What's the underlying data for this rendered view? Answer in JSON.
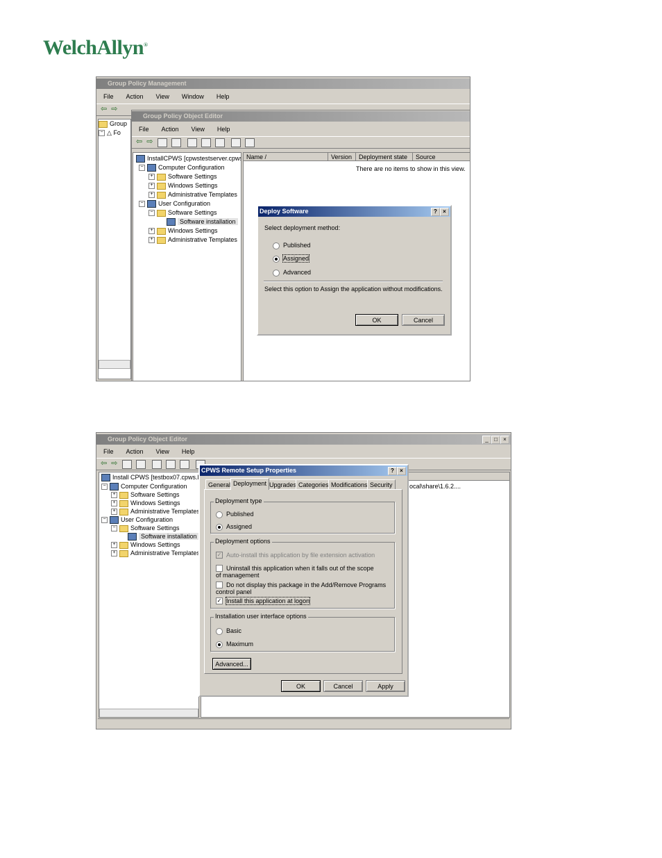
{
  "logo": {
    "text": "WelchAllyn",
    "reg": "®"
  },
  "s1": {
    "gpm": {
      "title": "Group Policy Management",
      "menu": [
        "File",
        "Action",
        "View",
        "Window",
        "Help"
      ],
      "tree": [
        "Group",
        "Fo"
      ]
    },
    "gpoe": {
      "title": "Group Policy Object Editor",
      "menu": [
        "File",
        "Action",
        "View",
        "Help"
      ],
      "tree": [
        "InstallCPWS [cpwstestserver.cpws",
        "Computer Configuration",
        "Software Settings",
        "Windows Settings",
        "Administrative Templates",
        "User Configuration",
        "Software Settings",
        "Software installation",
        "Windows Settings",
        "Administrative Templates"
      ],
      "columns": [
        "Name",
        "Version",
        "Deployment state",
        "Source"
      ],
      "empty": "There are no items to show in this view."
    },
    "deploy": {
      "title": "Deploy Software",
      "prompt": "Select deployment method:",
      "options": [
        "Published",
        "Assigned",
        "Advanced"
      ],
      "desc": "Select this option to Assign the application without modifications.",
      "ok": "OK",
      "cancel": "Cancel",
      "help": "?",
      "close": "×"
    }
  },
  "s2": {
    "gpoe": {
      "title": "Group Policy Object Editor",
      "menu": [
        "File",
        "Action",
        "View",
        "Help"
      ],
      "tree": [
        "Install CPWS [testbox07.cpws.loca",
        "Computer Configuration",
        "Software Settings",
        "Windows Settings",
        "Administrative Templates",
        "User Configuration",
        "Software Settings",
        "Software installation",
        "Windows Settings",
        "Administrative Templates"
      ],
      "source": "ocal\\share\\1.6.2....",
      "min": "_",
      "max": "□",
      "close": "×"
    },
    "props": {
      "title": "CPWS Remote Setup Properties",
      "help": "?",
      "close": "×",
      "tabs": [
        "General",
        "Deployment",
        "Upgrades",
        "Categories",
        "Modifications",
        "Security"
      ],
      "type_label": "Deployment type",
      "type_opts": [
        "Published",
        "Assigned"
      ],
      "opts_label": "Deployment options",
      "opts": [
        "Auto-install this application by file extension activation",
        "Uninstall this application when it falls out of the scope of management",
        "Do not display this package in the Add/Remove Programs control panel",
        "Install this application at logon"
      ],
      "ui_label": "Installation user interface options",
      "ui_opts": [
        "Basic",
        "Maximum"
      ],
      "advanced": "Advanced...",
      "ok": "OK",
      "cancel": "Cancel",
      "apply": "Apply"
    }
  }
}
